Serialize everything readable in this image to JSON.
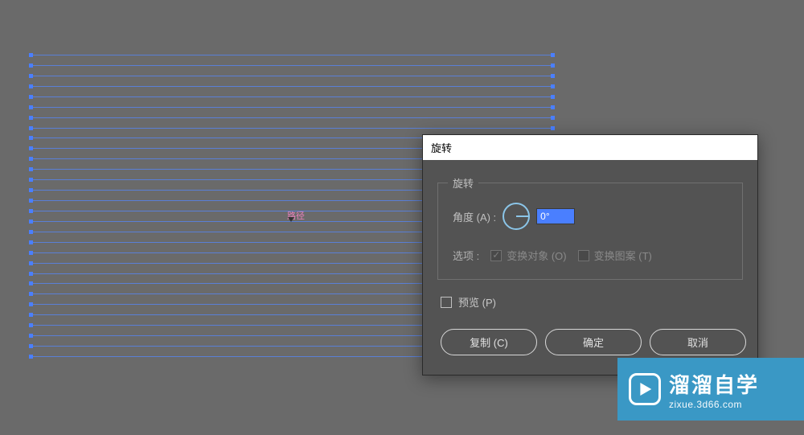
{
  "canvas": {
    "pivot_label": "路径",
    "line_count": 30
  },
  "dialog": {
    "title": "旋转",
    "fieldset_legend": "旋转",
    "angle_label": "角度 (A) :",
    "angle_value": "0°",
    "options_label": "选项 :",
    "transform_objects_label": "变换对象 (O)",
    "transform_patterns_label": "变换图案 (T)",
    "preview_label": "预览 (P)",
    "copy_button": "复制 (C)",
    "ok_button": "确定",
    "cancel_button": "取消"
  },
  "watermark": {
    "title": "溜溜自学",
    "url": "zixue.3d66.com"
  }
}
